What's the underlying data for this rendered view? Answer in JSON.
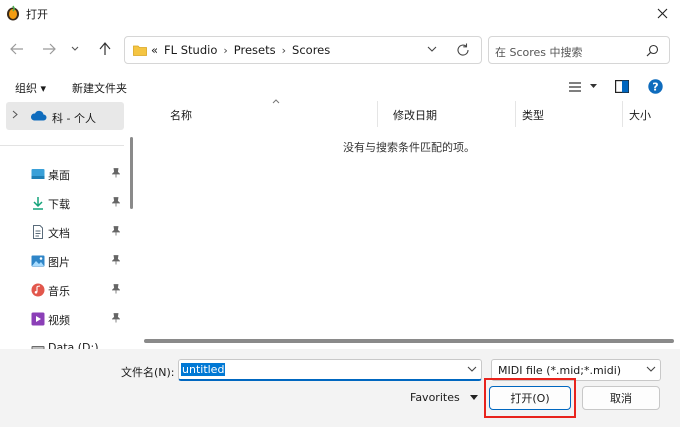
{
  "window": {
    "title": "打开"
  },
  "address": {
    "crumbs": [
      "«",
      "FL Studio",
      "Presets",
      "Scores"
    ]
  },
  "search": {
    "placeholder": "在 Scores 中搜索"
  },
  "toolbar": {
    "organize": "组织 ▾",
    "new_folder": "新建文件夹"
  },
  "sidebar": {
    "top_label": "科 - 个人",
    "items": [
      {
        "label": "桌面",
        "icon": "desktop-icon",
        "pinned": true
      },
      {
        "label": "下载",
        "icon": "download-icon",
        "pinned": true
      },
      {
        "label": "文档",
        "icon": "document-icon",
        "pinned": true
      },
      {
        "label": "图片",
        "icon": "pictures-icon",
        "pinned": true
      },
      {
        "label": "音乐",
        "icon": "music-icon",
        "pinned": true
      },
      {
        "label": "视频",
        "icon": "video-icon",
        "pinned": true
      },
      {
        "label": "Data (D:)",
        "icon": "drive-icon",
        "pinned": false
      }
    ]
  },
  "columns": {
    "name": "名称",
    "modified": "修改日期",
    "type": "类型",
    "size": "大小"
  },
  "empty_message": "没有与搜索条件匹配的项。",
  "filename": {
    "label": "文件名(N):",
    "value": "untitled"
  },
  "filetype": {
    "value": "MIDI file (*.mid;*.midi)"
  },
  "favorites": {
    "label": "Favorites"
  },
  "buttons": {
    "open": "打开(O)",
    "cancel": "取消"
  },
  "colors": {
    "accent": "#0067c0",
    "highlight": "#e8231c",
    "selection": "#0078d4"
  }
}
